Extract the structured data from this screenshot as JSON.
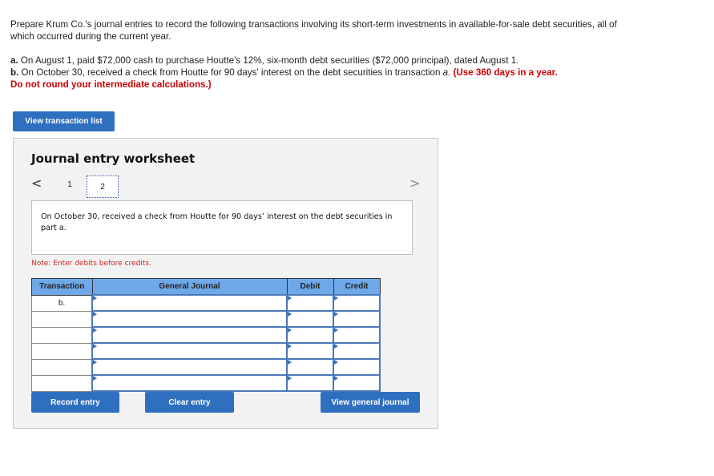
{
  "intro": {
    "paragraph": "Prepare Krum Co.'s journal entries to record the following transactions involving its short-term investments in available-for-sale debt securities, all of which occurred during the current year.",
    "item_a_label": "a.",
    "item_a_text": " On August 1, paid $72,000 cash to purchase Houtte's 12%, six-month debt securities ($72,000 principal), dated August 1.",
    "item_b_label": "b.",
    "item_b_text": " On October 30, received a check from Houtte for 90 days' interest on the debt securities in transaction ",
    "item_b_italic": "a.",
    "item_b_note": " (Use 360 days in a year.",
    "rounding_note": "Do not round your intermediate calculations.)"
  },
  "buttons": {
    "view_transaction_list": "View transaction list",
    "record_entry": "Record entry",
    "clear_entry": "Clear entry",
    "view_general_journal": "View general journal"
  },
  "worksheet": {
    "title": "Journal entry worksheet",
    "nav_prev": "<",
    "nav_next": ">",
    "tabs": [
      {
        "label": "1",
        "active": false
      },
      {
        "label": "2",
        "active": true
      }
    ],
    "description": "On October 30, received a check from Houtte for 90 days’ interest on the debt securities in part a.",
    "note": "Note: Enter debits before credits.",
    "table": {
      "headers": [
        "Transaction",
        "General Journal",
        "Debit",
        "Credit"
      ],
      "rows": [
        {
          "transaction": "b.",
          "account": "",
          "debit": "",
          "credit": ""
        },
        {
          "transaction": "",
          "account": "",
          "debit": "",
          "credit": ""
        },
        {
          "transaction": "",
          "account": "",
          "debit": "",
          "credit": ""
        },
        {
          "transaction": "",
          "account": "",
          "debit": "",
          "credit": ""
        },
        {
          "transaction": "",
          "account": "",
          "debit": "",
          "credit": ""
        },
        {
          "transaction": "",
          "account": "",
          "debit": "",
          "credit": ""
        }
      ]
    }
  },
  "colors": {
    "accent": "#2f6fbf",
    "header_blue": "#6fa8e8",
    "warning_red": "#cc0000",
    "panel_bg": "#f2f2f2"
  }
}
